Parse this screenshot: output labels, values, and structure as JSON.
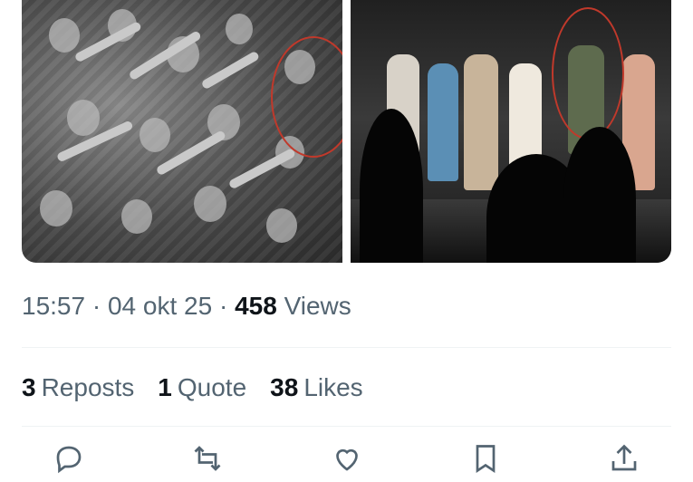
{
  "post": {
    "time": "15:57",
    "date": "04 okt 25",
    "views_count": "458",
    "views_label": "Views"
  },
  "stats": {
    "reposts_count": "3",
    "reposts_label": "Reposts",
    "quotes_count": "1",
    "quotes_label": "Quote",
    "likes_count": "38",
    "likes_label": "Likes"
  },
  "media": [
    {
      "icon": "historical-crowd-photo"
    },
    {
      "icon": "theater-stage-photo"
    }
  ],
  "actions": [
    {
      "icon": "reply-icon"
    },
    {
      "icon": "repost-icon"
    },
    {
      "icon": "like-icon"
    },
    {
      "icon": "bookmark-icon"
    },
    {
      "icon": "share-icon"
    }
  ],
  "colors": {
    "text_primary": "#0f1419",
    "text_secondary": "#536471",
    "divider": "#eff3f4",
    "annotation_circle": "#c0392b"
  }
}
